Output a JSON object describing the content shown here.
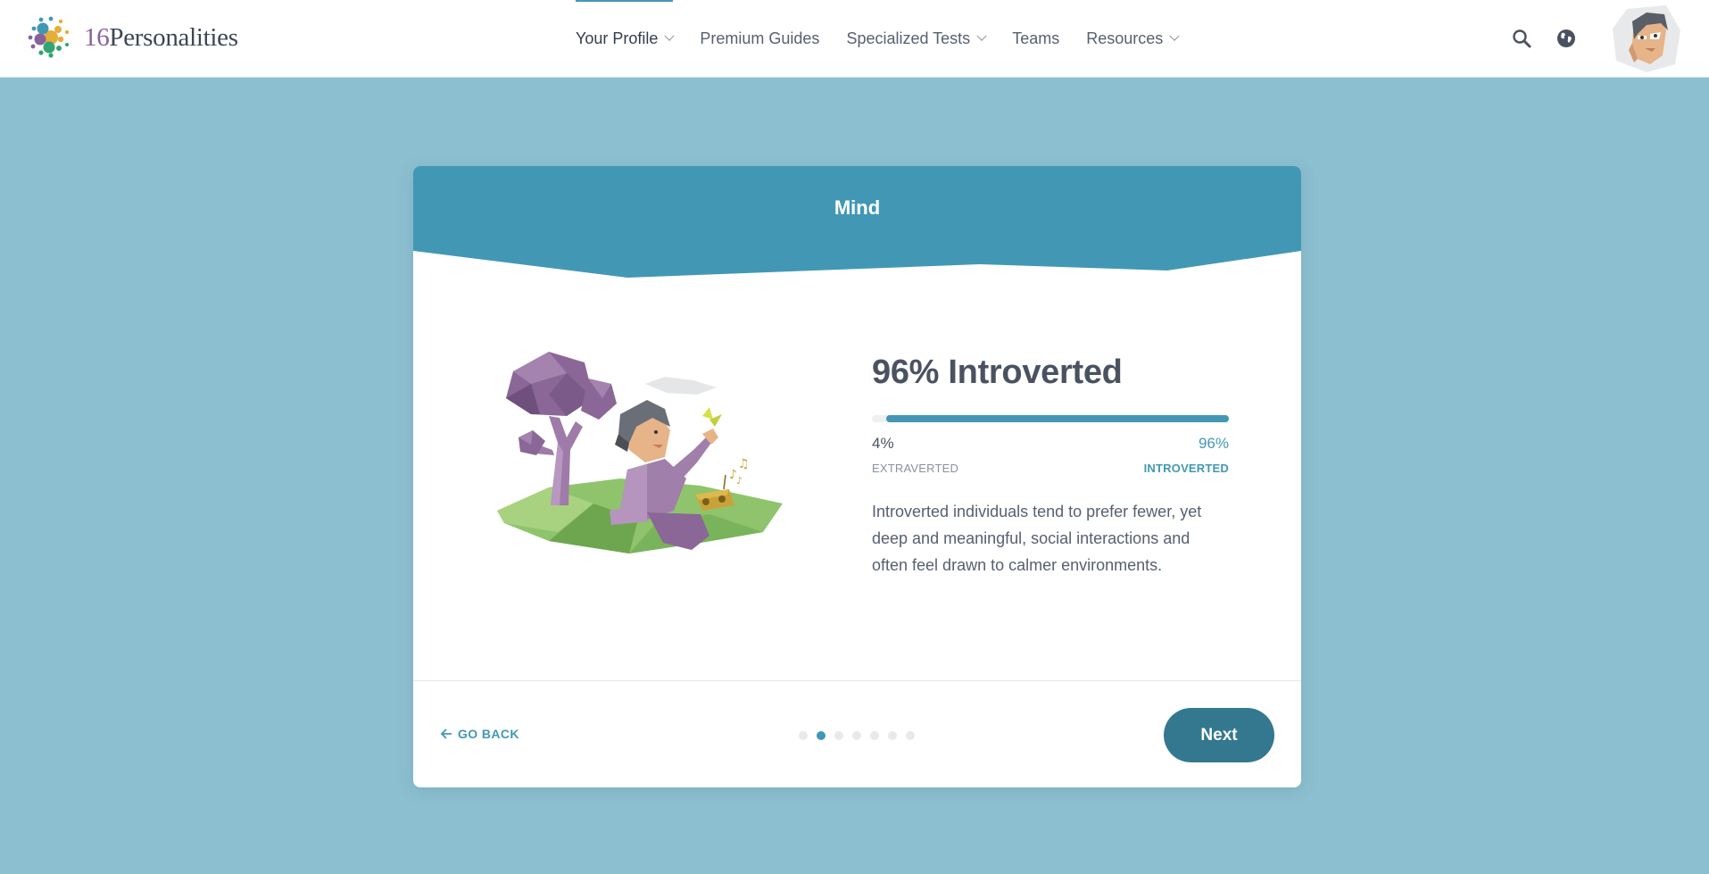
{
  "header": {
    "logo": {
      "number": "16",
      "word": "Personalities"
    },
    "nav": [
      {
        "label": "Your Profile",
        "dropdown": true,
        "active": true
      },
      {
        "label": "Premium Guides",
        "dropdown": false,
        "active": false
      },
      {
        "label": "Specialized Tests",
        "dropdown": true,
        "active": false
      },
      {
        "label": "Teams",
        "dropdown": false,
        "active": false
      },
      {
        "label": "Resources",
        "dropdown": true,
        "active": false
      }
    ],
    "icons": [
      "search-icon",
      "globe-icon",
      "avatar"
    ]
  },
  "card": {
    "title": "Mind",
    "result_title": "96% Introverted",
    "progress_fraction": 0.96,
    "left_pct": "4%",
    "right_pct": "96%",
    "left_label": "EXTRAVERTED",
    "right_label": "INTROVERTED",
    "description": "Introverted individuals tend to prefer fewer, yet deep and meaningful, social interactions and often feel drawn to calmer environments.",
    "go_back": "GO BACK",
    "next": "Next",
    "steps_total": 7,
    "steps_active_index": 1
  },
  "colors": {
    "page_bg": "#8cbfd0",
    "accent": "#4298b4",
    "next_button": "#33788f",
    "card_header": "#4298b4"
  }
}
